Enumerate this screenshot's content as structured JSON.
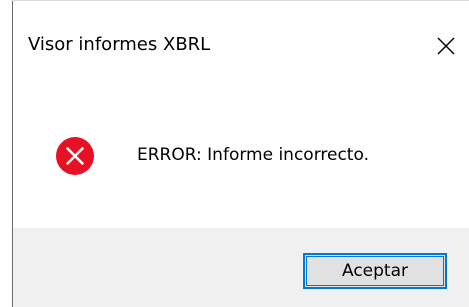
{
  "window": {
    "title": "Visor informes XBRL",
    "close_icon": "close-icon"
  },
  "dialog": {
    "icon": "error-icon",
    "icon_color": "#e81123",
    "message": "ERROR: Informe incorrecto."
  },
  "buttons": {
    "ok_label": "Aceptar",
    "accent": "#0078d7"
  }
}
